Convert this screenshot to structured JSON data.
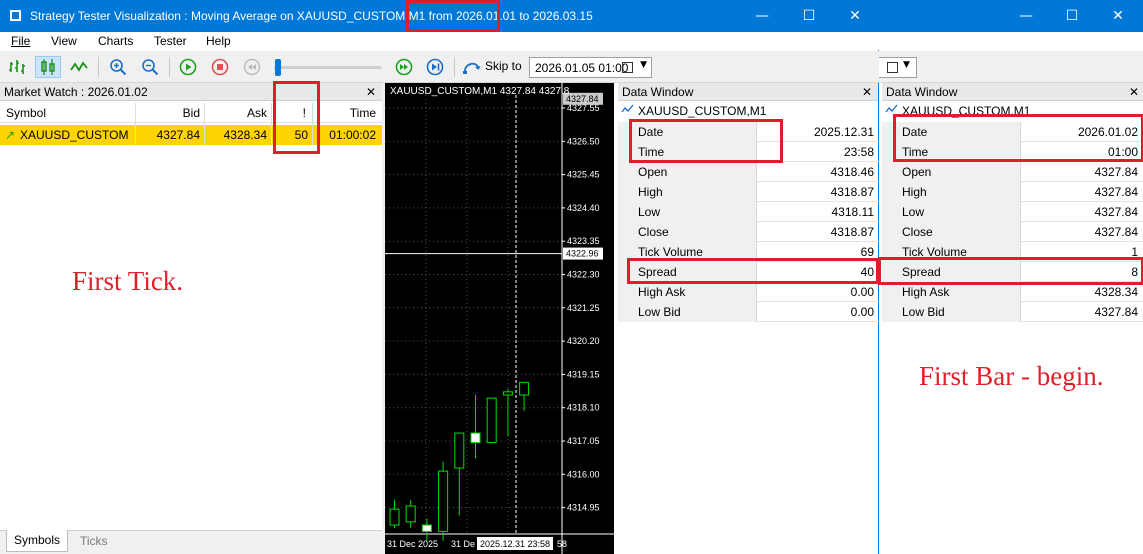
{
  "window_main": {
    "title": "Strategy Tester Visualization : Moving Average on XAUUSD_CUSTOM,M1 from 2026.01.01 to 2026.03.15"
  },
  "window_controls": {
    "minimize": "—",
    "maximize": "☐",
    "close": "✕"
  },
  "menu": {
    "file": "File",
    "view": "View",
    "charts": "Charts",
    "tester": "Tester",
    "help": "Help"
  },
  "toolbar": {
    "skip_label": "Skip to",
    "skip_value": "2026.01.05 01:00",
    "slider_progress": 0.02
  },
  "market_watch": {
    "title": "Market Watch : 2026.01.02",
    "columns": {
      "symbol": "Symbol",
      "bid": "Bid",
      "ask": "Ask",
      "spread": "!",
      "time": "Time"
    },
    "row": {
      "symbol": "XAUUSD_CUSTOM",
      "bid": "4327.84",
      "ask": "4328.34",
      "spread": "50",
      "time": "01:00:02"
    },
    "tabs": {
      "symbols": "Symbols",
      "ticks": "Ticks"
    }
  },
  "chart": {
    "header": "XAUUSD_CUSTOM,M1  4327.84 4327.8",
    "price_tag": "4327.84",
    "crosshair_price": "4322.96",
    "price_labels": [
      "4327.55",
      "4326.50",
      "4325.45",
      "4324.40",
      "4323.35",
      "4322.30",
      "4321.25",
      "4320.20",
      "4319.15",
      "4318.10",
      "4317.05",
      "4316.00",
      "4314.95"
    ],
    "x_labels": [
      "31 Dec 2025",
      "31 De"
    ],
    "crosshair_time": "2025.12.31 23:58",
    "x_tail": "58"
  },
  "chart_data": {
    "type": "candlestick",
    "title": "XAUUSD_CUSTOM,M1",
    "ylim": [
      4314.3,
      4327.9
    ],
    "candles": [
      {
        "open": 4314.4,
        "close": 4314.9,
        "high": 4315.2,
        "low": 4314.3,
        "bull": true
      },
      {
        "open": 4315.0,
        "close": 4314.5,
        "high": 4315.2,
        "low": 4314.3,
        "bull": true
      },
      {
        "open": 4314.4,
        "close": 4314.2,
        "high": 4314.6,
        "low": 4313.9,
        "bull": false
      },
      {
        "open": 4314.2,
        "close": 4316.1,
        "high": 4316.4,
        "low": 4313.9,
        "bull": true
      },
      {
        "open": 4316.2,
        "close": 4317.3,
        "high": 4317.3,
        "low": 4314.7,
        "bull": true
      },
      {
        "open": 4317.3,
        "close": 4317.0,
        "high": 4318.5,
        "low": 4316.5,
        "bull": false
      },
      {
        "open": 4317.0,
        "close": 4318.4,
        "high": 4318.4,
        "low": 4317.0,
        "bull": true
      },
      {
        "open": 4318.5,
        "close": 4318.6,
        "high": 4318.7,
        "low": 4317.2,
        "bull": true
      },
      {
        "open": 4318.5,
        "close": 4318.9,
        "high": 4318.9,
        "low": 4318.0,
        "bull": true
      }
    ]
  },
  "data_window_1": {
    "title": "Data Window",
    "symbol": "XAUUSD_CUSTOM,M1",
    "rows": [
      {
        "label": "Date",
        "value": "2025.12.31"
      },
      {
        "label": "Time",
        "value": "23:58"
      },
      {
        "label": "Open",
        "value": "4318.46"
      },
      {
        "label": "High",
        "value": "4318.87"
      },
      {
        "label": "Low",
        "value": "4318.11"
      },
      {
        "label": "Close",
        "value": "4318.87"
      },
      {
        "label": "Tick Volume",
        "value": "69"
      },
      {
        "label": "Spread",
        "value": "40"
      },
      {
        "label": "High Ask",
        "value": "0.00"
      },
      {
        "label": "Low Bid",
        "value": "0.00"
      }
    ]
  },
  "data_window_2": {
    "title": "Data Window",
    "symbol": "XAUUSD_CUSTOM,M1",
    "rows": [
      {
        "label": "Date",
        "value": "2026.01.02"
      },
      {
        "label": "Time",
        "value": "01:00"
      },
      {
        "label": "Open",
        "value": "4327.84"
      },
      {
        "label": "High",
        "value": "4327.84"
      },
      {
        "label": "Low",
        "value": "4327.84"
      },
      {
        "label": "Close",
        "value": "4327.84"
      },
      {
        "label": "Tick Volume",
        "value": "1"
      },
      {
        "label": "Spread",
        "value": "8"
      },
      {
        "label": "High Ask",
        "value": "4328.34"
      },
      {
        "label": "Low Bid",
        "value": "4327.84"
      }
    ]
  },
  "annotations": {
    "first_tick": "First Tick.",
    "first_bar": "First Bar - begin."
  },
  "colors": {
    "titlebar": "#0078d7",
    "selection": "#ffd400",
    "annotation": "#dc1f2a",
    "bull": "#00dd00"
  }
}
